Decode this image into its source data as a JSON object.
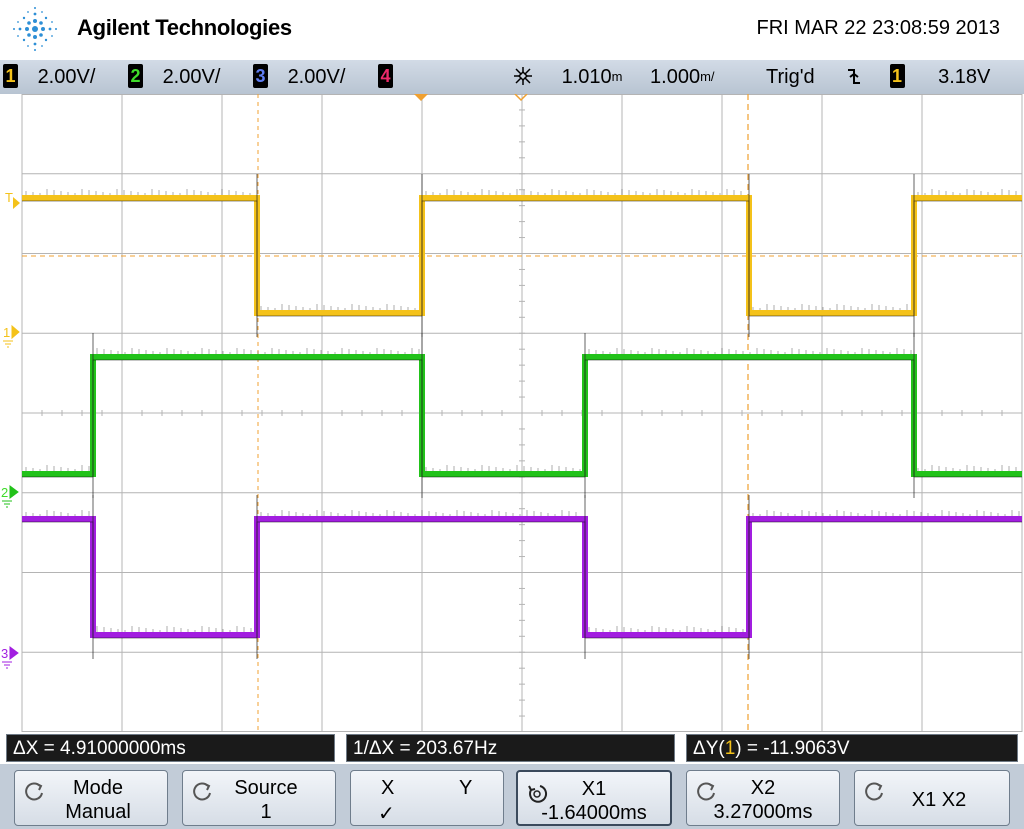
{
  "header": {
    "brand": "Agilent Technologies",
    "datetime": "FRI MAR 22 23:08:59 2013"
  },
  "statusbar": {
    "channels": [
      {
        "num": "1",
        "scale": "2.00V/",
        "color": "#f4c21a"
      },
      {
        "num": "2",
        "scale": "2.00V/",
        "color": "#3fdc2a"
      },
      {
        "num": "3",
        "scale": "2.00V/",
        "color": "#5e7cf0"
      },
      {
        "num": "4",
        "scale": "",
        "color": "#ee2a6a"
      }
    ],
    "delay": "1.010",
    "delay_unit": "m",
    "timebase": "1.000",
    "timebase_unit": "m/",
    "trig_state": "Trig'd",
    "trig_source": "1",
    "trig_level": "3.18V"
  },
  "markers": {
    "ch1": "1",
    "ch2": "2",
    "ch3": "3",
    "trigger": "T"
  },
  "readouts": {
    "delta_x": "ΔX = 4.91000000ms",
    "inv_delta_x": "1/ΔX = 203.67Hz",
    "delta_y_prefix": "ΔY(",
    "delta_y_ch": "1",
    "delta_y_suffix": ") = -11.9063V"
  },
  "softkeys": {
    "mode_label": "Mode",
    "mode_value": "Manual",
    "source_label": "Source",
    "source_value": "1",
    "x_label": "X",
    "y_label": "Y",
    "x_selected": "✓",
    "x1_label": "X1",
    "x1_value": "-1.64000ms",
    "x2_label": "X2",
    "x2_value": "3.27000ms",
    "x1x2_label": "X1 X2"
  },
  "colors": {
    "ch1": "#f4c21a",
    "ch2": "#22c21a",
    "ch3": "#a21ee0",
    "cursor": "#f0a030",
    "grid": "#b4b4b4"
  },
  "traces": {
    "ch1": [
      [
        0,
        "H"
      ],
      [
        2.35,
        "L"
      ],
      [
        4.0,
        "H"
      ],
      [
        7.27,
        "L"
      ],
      [
        8.92,
        "H"
      ]
    ],
    "ch2": [
      [
        0,
        "L"
      ],
      [
        0.71,
        "H"
      ],
      [
        4.0,
        "L"
      ],
      [
        5.63,
        "H"
      ],
      [
        8.92,
        "L"
      ]
    ],
    "ch3": [
      [
        0,
        "H"
      ],
      [
        0.71,
        "L"
      ],
      [
        2.35,
        "H"
      ],
      [
        5.63,
        "L"
      ],
      [
        7.27,
        "H"
      ]
    ]
  }
}
